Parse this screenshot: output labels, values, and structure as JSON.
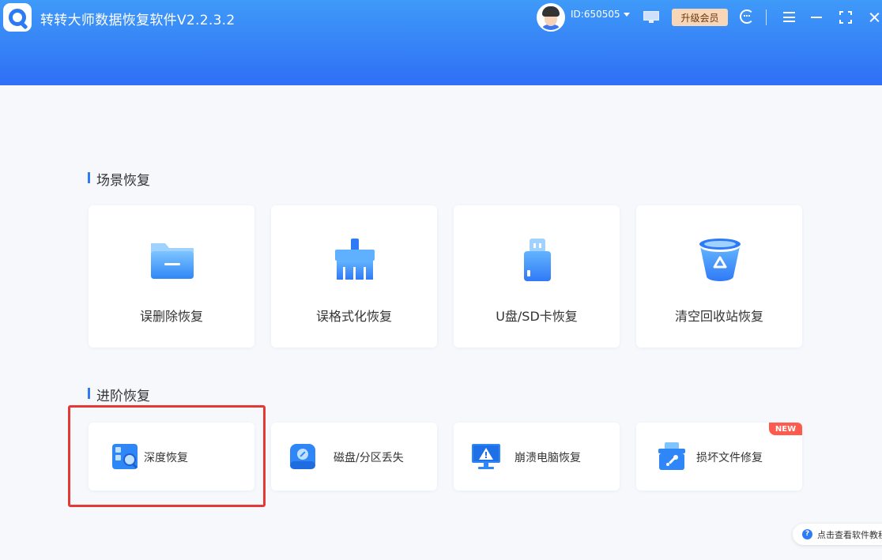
{
  "app": {
    "title": "转转大师数据恢复软件V2.2.3.2"
  },
  "header": {
    "user_id": "ID:650505",
    "vip_label": "升级会员"
  },
  "scene_recovery": {
    "title": "场景恢复",
    "items": [
      {
        "label": "误删除恢复",
        "icon": "folder-icon"
      },
      {
        "label": "误格式化恢复",
        "icon": "broom-icon"
      },
      {
        "label": "U盘/SD卡恢复",
        "icon": "usb-drive-icon"
      },
      {
        "label": "清空回收站恢复",
        "icon": "recycle-bin-icon"
      }
    ]
  },
  "advanced_recovery": {
    "title": "进阶恢复",
    "items": [
      {
        "label": "深度恢复",
        "icon": "deep-scan-icon",
        "highlighted": true
      },
      {
        "label": "磁盘/分区丢失",
        "icon": "disk-icon"
      },
      {
        "label": "崩溃电脑恢复",
        "icon": "crashed-monitor-icon"
      },
      {
        "label": "损坏文件修复",
        "icon": "repair-file-icon",
        "badge": "NEW"
      }
    ]
  },
  "help": {
    "label": "点击查看软件教程"
  },
  "colors": {
    "header_gradient_top": "#3f9af8",
    "header_gradient_bottom": "#2f6ff6",
    "accent": "#2f7af6",
    "highlight_border": "#e53935",
    "new_badge": "#ff5a4e",
    "vip_button": "#f8d7b8"
  }
}
